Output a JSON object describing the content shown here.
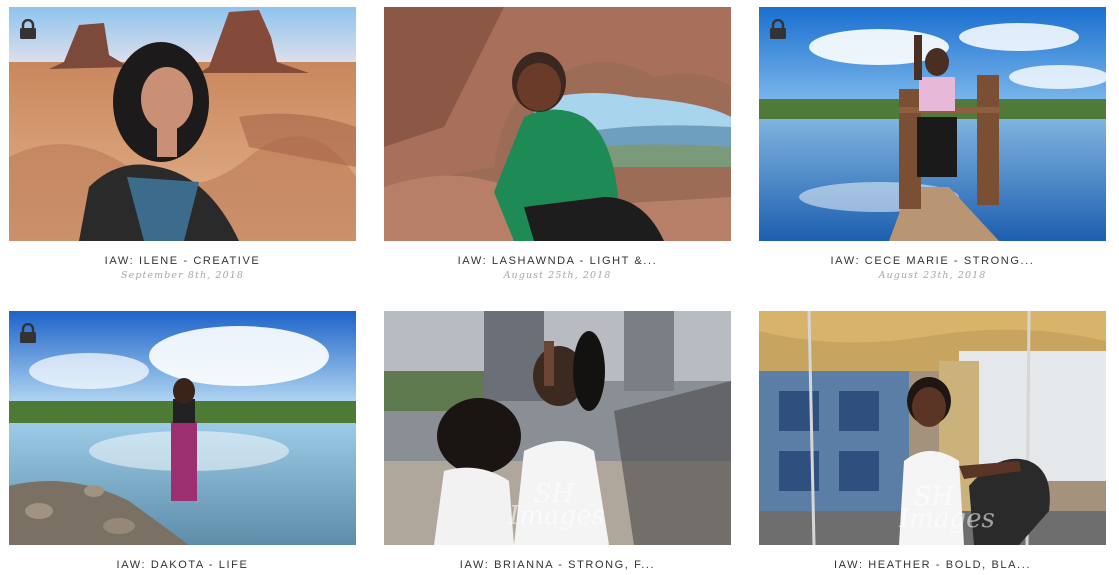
{
  "gallery": {
    "posts": [
      {
        "title": "IAW: ILENE - CREATIVE",
        "date": "September 8th, 2018",
        "locked": true
      },
      {
        "title": "IAW: LASHAWNDA - LIGHT &...",
        "date": "August 25th, 2018",
        "locked": false
      },
      {
        "title": "IAW: CECE MARIE - STRONG...",
        "date": "August 23th, 2018",
        "locked": true
      },
      {
        "title": "IAW: DAKOTA - LIFE",
        "date": "",
        "locked": true
      },
      {
        "title": "IAW: BRIANNA - STRONG, F...",
        "date": "",
        "locked": false
      },
      {
        "title": "IAW: HEATHER - BOLD, BLA...",
        "date": "",
        "locked": false
      }
    ],
    "watermark": "SH Images"
  },
  "icons": {
    "lock": "lock-icon"
  },
  "colors": {
    "title_text": "#333333",
    "date_text": "#a6a6a6",
    "background": "#ffffff"
  }
}
